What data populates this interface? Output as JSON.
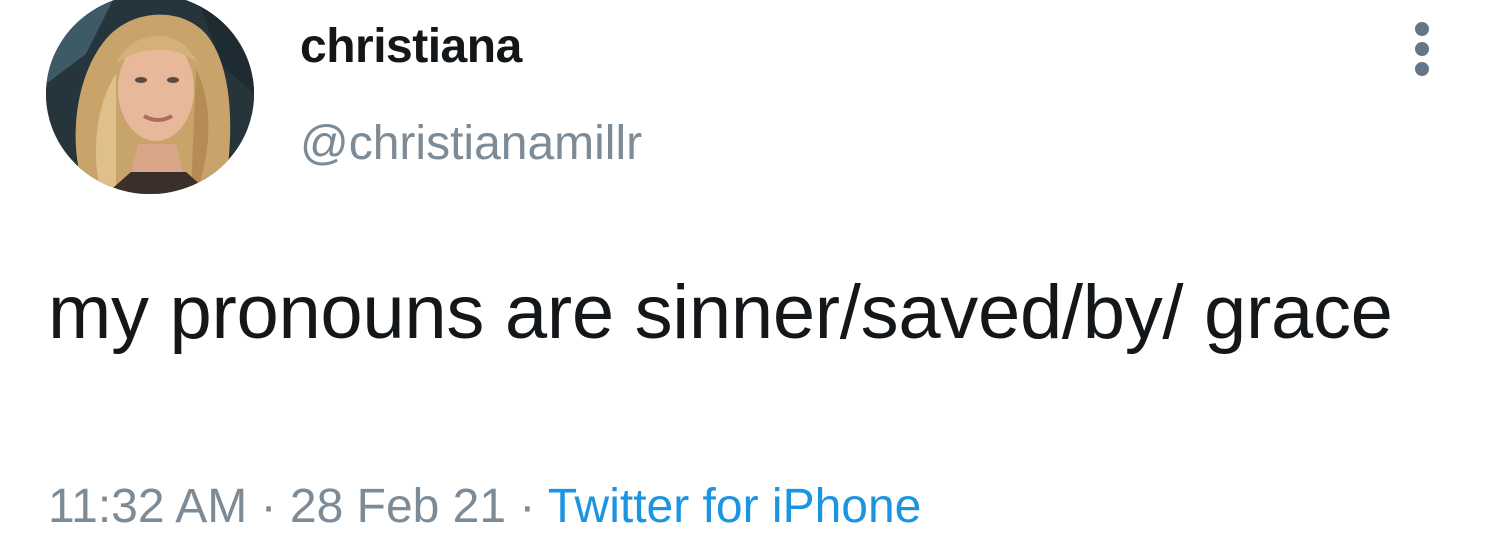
{
  "user": {
    "display_name": "christiana",
    "handle": "@christianamillr"
  },
  "tweet": {
    "text": "my pronouns are sinner/saved/by/ grace",
    "timestamp": "11:32 AM · 28 Feb 21 ·",
    "source": "Twitter for iPhone"
  },
  "icons": {
    "more": "more-vertical-icon"
  },
  "colors": {
    "text": "#14171a",
    "secondary": "#7d8b97",
    "link": "#1b95e0"
  }
}
